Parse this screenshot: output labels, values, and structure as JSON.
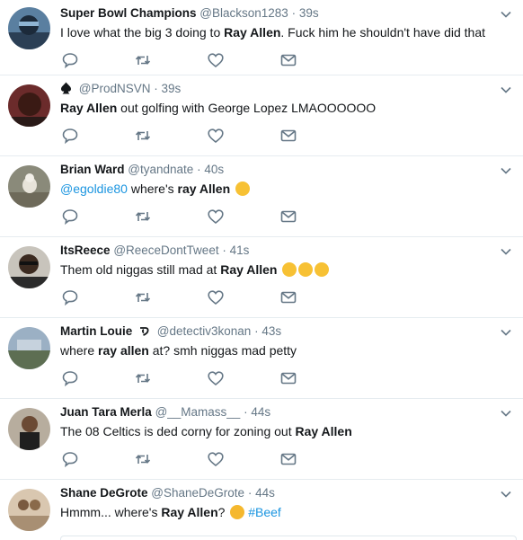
{
  "colors": {
    "link": "#1b95e0",
    "text": "#14171a",
    "meta": "#657786",
    "divider": "#e6ecf0",
    "icon": "#657786"
  },
  "tweets": [
    {
      "name": "Super Bowl Champions",
      "handle": "@Blackson1283",
      "time": "39s",
      "parts": [
        {
          "t": "I love what the big 3 doing to ",
          "s": "normal"
        },
        {
          "t": "Ray Allen",
          "s": "bold"
        },
        {
          "t": ". Fuck him he shouldn't have did that",
          "s": "normal"
        }
      ]
    },
    {
      "name": "",
      "badge": "spade-icon",
      "handle": "@ProdNSVN",
      "time": "39s",
      "parts": [
        {
          "t": "Ray Allen",
          "s": "bold"
        },
        {
          "t": " out golfing with George Lopez LMAOOOOOO",
          "s": "normal"
        }
      ]
    },
    {
      "name": "Brian Ward",
      "handle": "@tyandnate",
      "time": "40s",
      "parts": [
        {
          "t": "@egoldie80",
          "s": "link"
        },
        {
          "t": " where's ",
          "s": "normal"
        },
        {
          "t": "ray Allen",
          "s": "bold"
        }
      ],
      "emoji_count": 1
    },
    {
      "name": "ItsReece",
      "handle": "@ReeceDontTweet",
      "time": "41s",
      "parts": [
        {
          "t": "Them old niggas still mad at ",
          "s": "normal"
        },
        {
          "t": "Ray Allen",
          "s": "bold"
        }
      ],
      "emoji_count": 3
    },
    {
      "name": "Martin Louie",
      "name_icon": "curl-symbol",
      "handle": "@detectiv3konan",
      "time": "43s",
      "parts": [
        {
          "t": "where ",
          "s": "normal"
        },
        {
          "t": "ray allen",
          "s": "bold"
        },
        {
          "t": " at? smh niggas mad petty",
          "s": "normal"
        }
      ]
    },
    {
      "name": "Juan Tara Merla",
      "handle": "@__Mamass__",
      "time": "44s",
      "parts": [
        {
          "t": "The 08 Celtics is ded corny for zoning out ",
          "s": "normal"
        },
        {
          "t": "Ray Allen",
          "s": "bold"
        }
      ]
    },
    {
      "name": "Shane DeGrote",
      "handle": "@ShaneDeGrote",
      "time": "44s",
      "parts": [
        {
          "t": "Hmmm... where's ",
          "s": "normal"
        },
        {
          "t": "Ray Allen",
          "s": "bold"
        },
        {
          "t": "? ",
          "s": "normal"
        },
        {
          "t": "#Beef",
          "s": "link"
        }
      ],
      "emoji_thinking": true
    }
  ]
}
